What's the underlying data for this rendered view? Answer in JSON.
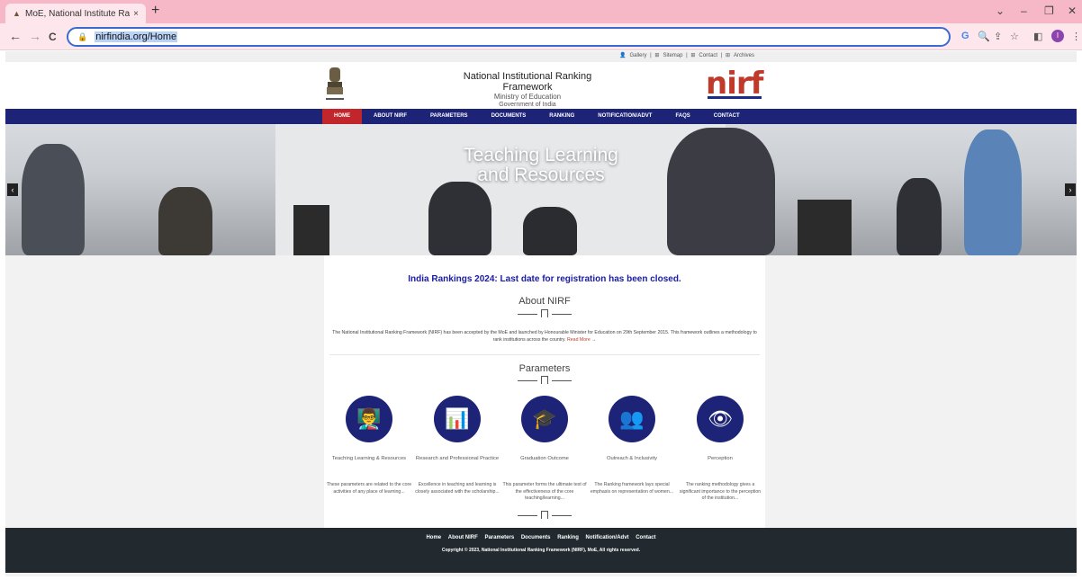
{
  "browser": {
    "tab_title": "MoE, National Institute Ranking",
    "tab_close": "×",
    "new_tab": "+",
    "url": "nirfindia.org/Home",
    "min": "–",
    "restore": "❐",
    "close": "✕",
    "chevron": "⌄",
    "back": "←",
    "forward": "→",
    "reload": "C",
    "profile_initial": "I"
  },
  "site": {
    "top_links": [
      "Gallery",
      "Sitemap",
      "Contact",
      "Archives"
    ],
    "brand": {
      "title": "National Institutional Ranking Framework",
      "ministry": "Ministry of Education",
      "gov": "Government of India",
      "logo": "nirf"
    },
    "menu": [
      "HOME",
      "ABOUT NIRF",
      "PARAMETERS",
      "DOCUMENTS",
      "RANKING",
      "NOTIFICATION/ADVT",
      "FAQS",
      "CONTACT"
    ],
    "banner": {
      "line1": "Teaching Learning",
      "line2": "and Resources",
      "prev": "‹",
      "next": "›"
    },
    "notice": "India Rankings 2024: Last date for registration has been closed.",
    "about": {
      "title": "About NIRF",
      "text": "The National Institutional Ranking Framework (NIRF) has been accepted by the MoE and launched by Honourable Minister for Education on 29th September 2015. This framework outlines a methodology to rank institutions across the country.",
      "read_more": "Read More →"
    },
    "parameters": {
      "title": "Parameters",
      "items": [
        {
          "icon": "👨‍🏫",
          "name": "Teaching Learning & Resources",
          "desc": "These parameters are related to the core activities of any place of learning..."
        },
        {
          "icon": "📊",
          "name": "Research and Professional Practice",
          "desc": "Excellence in teaching and learning is closely associated with the scholarship..."
        },
        {
          "icon": "🎓",
          "name": "Graduation Outcome",
          "desc": "This parameter forms the ultimate test of the effectiveness of the core teaching/learning..."
        },
        {
          "icon": "👥",
          "name": "Outreach & Inclusivity",
          "desc": "The Ranking framework lays special emphasis on representation of women..."
        },
        {
          "icon": "👁",
          "name": "Perception",
          "desc": "The ranking methodology gives a significant importance to the perception of the institution..."
        }
      ]
    },
    "footer": {
      "links": [
        "Home",
        "About NIRF",
        "Parameters",
        "Documents",
        "Ranking",
        "Notification/Advt",
        "Contact"
      ],
      "copyright": "Copyright © 2023, National Institutional Ranking Framework (NIRF), MoE, All rights reserved."
    }
  }
}
